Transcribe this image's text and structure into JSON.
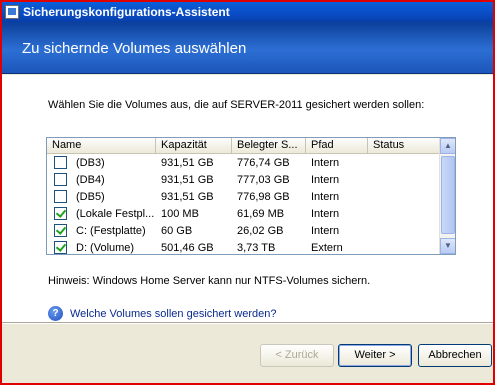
{
  "window": {
    "title": "Sicherungskonfigurations-Assistent",
    "icon": "app-icon"
  },
  "header": {
    "title": "Zu sichernde Volumes auswählen"
  },
  "intro_text": "Wählen Sie die Volumes aus, die auf SERVER-2011 gesichert werden sollen:",
  "table": {
    "columns": [
      "Name",
      "Kapazität",
      "Belegter S...",
      "Pfad",
      "Status"
    ],
    "rows": [
      {
        "checked": false,
        "name": "(DB3)",
        "capacity": "931,51 GB",
        "used": "776,74 GB",
        "path": "Intern",
        "status": ""
      },
      {
        "checked": false,
        "name": "(DB4)",
        "capacity": "931,51 GB",
        "used": "777,03 GB",
        "path": "Intern",
        "status": ""
      },
      {
        "checked": false,
        "name": "(DB5)",
        "capacity": "931,51 GB",
        "used": "776,98 GB",
        "path": "Intern",
        "status": ""
      },
      {
        "checked": true,
        "name": "(Lokale Festpl...",
        "capacity": "100 MB",
        "used": "61,69 MB",
        "path": "Intern",
        "status": ""
      },
      {
        "checked": true,
        "name": "C: (Festplatte)",
        "capacity": "60 GB",
        "used": "26,02 GB",
        "path": "Intern",
        "status": ""
      },
      {
        "checked": true,
        "name": "D: (Volume)",
        "capacity": "501,46 GB",
        "used": "3,73 TB",
        "path": "Extern",
        "status": ""
      }
    ]
  },
  "hint_text": "Hinweis: Windows Home Server kann nur NTFS-Volumes sichern.",
  "help": {
    "icon": "help-icon",
    "link_text": "Welche Volumes sollen gesichert werden?"
  },
  "buttons": {
    "back": "< Zurück",
    "next": "Weiter >",
    "cancel": "Abbrechen"
  },
  "colors": {
    "header_bg": "#2d6fd4",
    "titlebar_bg": "#0a4bc4",
    "frame_border": "#e00000",
    "link": "#0a2b8f"
  }
}
